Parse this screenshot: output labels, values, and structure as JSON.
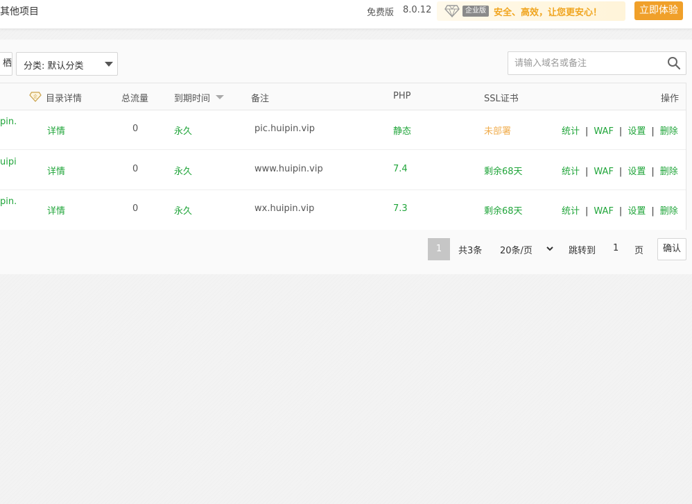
{
  "header": {
    "breadcrumb": "其他项目",
    "edition": "免费版",
    "version": "8.0.12",
    "promo": {
      "badge": "企业版",
      "slogan": "安全、高效，让您更安心！",
      "icon": "diamond-icon"
    },
    "try_button": "立即体验"
  },
  "toolbar": {
    "left_button_fragment": "栖",
    "category_select": "分类: 默认分类",
    "search_placeholder": "请输入域名或备注"
  },
  "table": {
    "columns": [
      "目录详情",
      "总流量",
      "到期时间",
      "备注",
      "PHP",
      "SSL证书",
      "操作"
    ],
    "rows": [
      {
        "name_fragment": "pin.",
        "detail": "详情",
        "traffic": "0",
        "expiry": "永久",
        "remark": "pic.huipin.vip",
        "php": "静态",
        "ssl": "未部署",
        "actions": [
          "统计",
          "WAF",
          "设置",
          "删除"
        ]
      },
      {
        "name_fragment": "uipi",
        "detail": "详情",
        "traffic": "0",
        "expiry": "永久",
        "remark": "www.huipin.vip",
        "php": "7.4",
        "ssl": "剩余68天",
        "actions": [
          "统计",
          "WAF",
          "设置",
          "删除"
        ]
      },
      {
        "name_fragment": "pin.",
        "detail": "详情",
        "traffic": "0",
        "expiry": "永久",
        "remark": "wx.huipin.vip",
        "php": "7.3",
        "ssl": "剩余68天",
        "actions": [
          "统计",
          "WAF",
          "设置",
          "删除"
        ]
      }
    ]
  },
  "pagination": {
    "current_page": "1",
    "total": "共3条",
    "per_page": "20条/页",
    "jump_label": "跳转到",
    "jump_value": "1",
    "page_unit": "页",
    "confirm": "确认"
  },
  "colors": {
    "accent_green": "#20a53a",
    "warning_orange": "#f0ad4e",
    "promo_button": "#f0a02a"
  }
}
